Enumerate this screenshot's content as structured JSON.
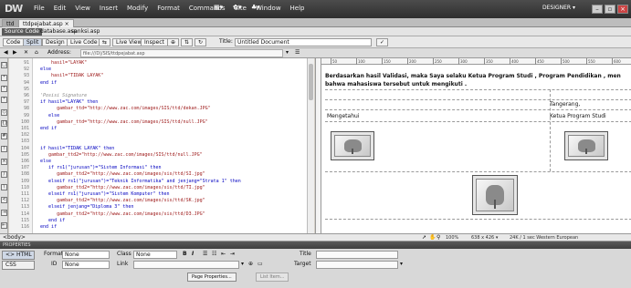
{
  "app": {
    "logo": "DW",
    "menus": [
      "File",
      "Edit",
      "View",
      "Insert",
      "Modify",
      "Format",
      "Commands",
      "Site",
      "Window",
      "Help"
    ],
    "workspace": "DESIGNER ▾"
  },
  "tabs": {
    "file": "ttdpejabat.asp",
    "dir": "ttd",
    "close": "×"
  },
  "related": {
    "source_code": "Source Code",
    "files": [
      "database.asp",
      "sanksi.asp"
    ]
  },
  "doc_toolbar": {
    "code": "Code",
    "split": "Split",
    "design": "Design",
    "live_code": "Live Code",
    "live_view": "Live View",
    "inspect": "Inspect",
    "title_label": "Title:",
    "title_value": "Untitled Document"
  },
  "address": {
    "label": "Address:",
    "value": "file:///D|/SIS/ttdpejabat.asp"
  },
  "code": {
    "lines": [
      {
        "n": "91",
        "t": "      hasil=\"LAYAK\"",
        "c": "str"
      },
      {
        "n": "92",
        "t": "  else",
        "c": "kw"
      },
      {
        "n": "93",
        "t": "      hasil=\"TIDAK LAYAK\"",
        "c": "str"
      },
      {
        "n": "94",
        "t": "  end if",
        "c": "kw"
      },
      {
        "n": "95",
        "t": "",
        "c": ""
      },
      {
        "n": "96",
        "t": "  'Posisi Signature",
        "c": "cm"
      },
      {
        "n": "97",
        "t": "  if hasil=\"LAYAK\" then",
        "c": "kw"
      },
      {
        "n": "98",
        "t": "        gambar_ttd=\"http://www.zac.com/images/SIS/ttd/dekan.JPG\"",
        "c": "str"
      },
      {
        "n": "99",
        "t": "     else",
        "c": "kw"
      },
      {
        "n": "100",
        "t": "        gambar_ttd=\"http://www.zac.com/images/SIS/ttd/null.JPG\"",
        "c": "str"
      },
      {
        "n": "101",
        "t": "  end if",
        "c": "kw"
      },
      {
        "n": "102",
        "t": "",
        "c": ""
      },
      {
        "n": "103",
        "t": "",
        "c": ""
      },
      {
        "n": "104",
        "t": "  if hasil=\"TIDAK LAYAK\" then",
        "c": "kw"
      },
      {
        "n": "105",
        "t": "     gambar_ttd2=\"http://www.zac.com/images/SIS/ttd/null.JPG\"",
        "c": "str"
      },
      {
        "n": "106",
        "t": "  else",
        "c": "kw"
      },
      {
        "n": "107",
        "t": "     if rs1(\"jurusan\")=\"Sistem Informasi\" then",
        "c": "kw"
      },
      {
        "n": "108",
        "t": "        gambar_ttd2=\"http://www.zac.com/images/sis/ttd/SI.jpg\"",
        "c": "str"
      },
      {
        "n": "109",
        "t": "     elseif rs1(\"jurusan\")=\"Teknik Informatika\" and jenjang=\"Strata 1\" then",
        "c": "kw"
      },
      {
        "n": "110",
        "t": "        gambar_ttd2=\"http://www.zac.com/images/sis/ttd/TI.jpg\"",
        "c": "str"
      },
      {
        "n": "111",
        "t": "     elseif rs1(\"jurusan\")=\"Sistem Komputer\" then",
        "c": "kw"
      },
      {
        "n": "112",
        "t": "        gambar_ttd2=\"http://www.zac.com/images/sis/ttd/SK.jpg\"",
        "c": "str"
      },
      {
        "n": "113",
        "t": "     elseif jenjang=\"Diploma 3\" then",
        "c": "kw"
      },
      {
        "n": "114",
        "t": "        gambar_ttd2=\"http://www.zac.com/images/sis/ttd/D3.JPG\"",
        "c": "str"
      },
      {
        "n": "115",
        "t": "     end if",
        "c": "kw"
      },
      {
        "n": "116",
        "t": "  end if",
        "c": "kw"
      }
    ]
  },
  "design": {
    "ruler": [
      "50",
      "100",
      "150",
      "200",
      "250",
      "300",
      "350",
      "400",
      "450",
      "500",
      "550",
      "600"
    ],
    "statement1": "Berdasarkan hasil Validasi, maka Saya selaku Ketua Program Studi , Program Pendidikan , men",
    "statement2": "bahwa mahasiswa tersebut untuk mengikuti .",
    "place": "Tangerang,",
    "mengetahui": "Mengetahui",
    "kaprodi": "Ketua Program Studi"
  },
  "status": {
    "tag": "<body>",
    "zoom": "100%",
    "size": "638 x 426 ▾",
    "enc": "24K / 1 sec  Western European"
  },
  "props": {
    "header": "PROPERTIES",
    "html": "<> HTML",
    "css": "CSS",
    "format_label": "Format",
    "format_value": "None",
    "id_label": "ID",
    "id_value": "None",
    "class_label": "Class",
    "class_value": "None",
    "link_label": "Link",
    "title_label": "Title",
    "target_label": "Target",
    "page_properties": "Page Properties...",
    "list_item": "List Item..."
  }
}
